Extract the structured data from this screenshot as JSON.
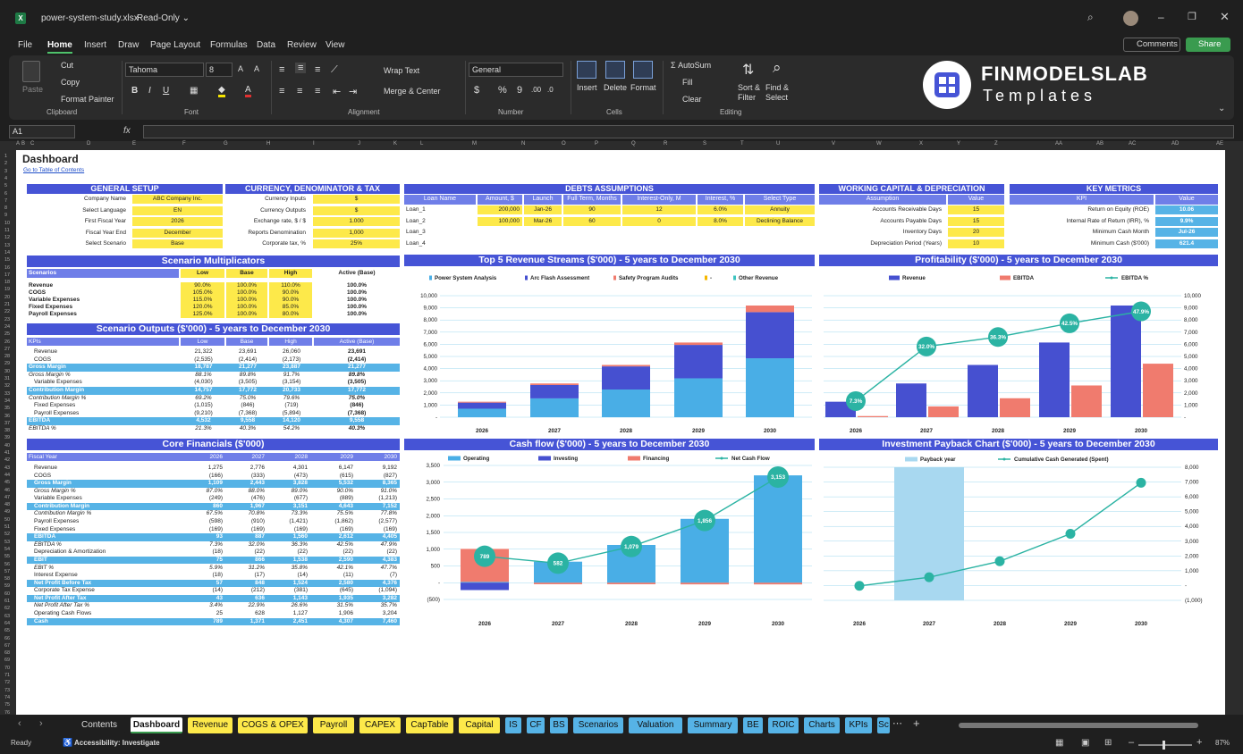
{
  "window": {
    "filename": "power-system-study.xlsx",
    "mode": "Read-Only"
  },
  "menu": [
    "File",
    "Home",
    "Insert",
    "Draw",
    "Page Layout",
    "Formulas",
    "Data",
    "Review",
    "View"
  ],
  "top_buttons": {
    "comments": "Comments",
    "share": "Share"
  },
  "ribbon": {
    "clipboard": {
      "paste": "Paste",
      "cut": "Cut",
      "copy": "Copy",
      "format_painter": "Format Painter",
      "label": "Clipboard"
    },
    "font": {
      "name": "Tahoma",
      "size": "8",
      "label": "Font"
    },
    "alignment": {
      "wrap": "Wrap Text",
      "merge": "Merge & Center",
      "label": "Alignment"
    },
    "number": {
      "format": "General",
      "label": "Number"
    },
    "cells": {
      "insert": "Insert",
      "delete": "Delete",
      "format": "Format",
      "label": "Cells"
    },
    "editing": {
      "autosum": "AutoSum",
      "fill": "Fill",
      "clear": "Clear",
      "sort": "Sort & Filter",
      "find": "Find & Select",
      "label": "Editing"
    },
    "logo": {
      "line1": "FINMODELSLAB",
      "line2": "Templates"
    }
  },
  "formula_bar": {
    "name_box": "A1",
    "fx": "fx"
  },
  "columns": [
    "A",
    "B",
    "C",
    "D",
    "E",
    "F",
    "G",
    "H",
    "I",
    "J",
    "K",
    "L",
    "M",
    "N",
    "O",
    "P",
    "Q",
    "R",
    "S",
    "T",
    "U",
    "V",
    "W",
    "X",
    "Y",
    "Z",
    "AA",
    "AB",
    "AC",
    "AD",
    "AE"
  ],
  "sheet": {
    "title": "Dashboard",
    "link": "Go to Table of Contents",
    "general_setup": {
      "title": "GENERAL SETUP",
      "rows": [
        [
          "Company Name",
          "ABC Company Inc."
        ],
        [
          "Select Language",
          "EN"
        ],
        [
          "First Fiscal Year",
          "2026"
        ],
        [
          "Fiscal Year End",
          "December"
        ],
        [
          "Select Scenario",
          "Base"
        ]
      ]
    },
    "currency": {
      "title": "CURRENCY, DENOMINATOR & TAX",
      "rows": [
        [
          "Currency Inputs",
          "$"
        ],
        [
          "Currency Outputs",
          "$"
        ],
        [
          "Exchange rate, $ / $",
          "1.000"
        ],
        [
          "Reports Denomination",
          "1,000"
        ],
        [
          "Corporate tax, %",
          "25%"
        ]
      ]
    },
    "debts": {
      "title": "DEBTS ASSUMPTIONS",
      "headers": [
        "Loan Name",
        "Amount, $",
        "Launch",
        "Full Term, Months",
        "Interest-Only, M",
        "Interest, %",
        "Select Type"
      ],
      "rows": [
        [
          "Loan_1",
          "200,000",
          "Jan-26",
          "90",
          "12",
          "6.0%",
          "Annuity"
        ],
        [
          "Loan_2",
          "100,000",
          "Mar-26",
          "60",
          "0",
          "8.0%",
          "Declining Balance"
        ],
        [
          "Loan_3",
          "",
          "",
          "",
          "",
          "",
          ""
        ],
        [
          "Loan_4",
          "",
          "",
          "",
          "",
          "",
          ""
        ]
      ]
    },
    "wc": {
      "title": "WORKING CAPITAL & DEPRECIATION",
      "headers": [
        "Assumption",
        "Value"
      ],
      "rows": [
        [
          "Accounts Receivable Days",
          "15"
        ],
        [
          "Accounts Payable Days",
          "15"
        ],
        [
          "Inventory Days",
          "20"
        ],
        [
          "Depreciation Period (Years)",
          "10"
        ]
      ]
    },
    "km": {
      "title": "KEY METRICS",
      "headers": [
        "KPI",
        "Value"
      ],
      "rows": [
        [
          "Return on Equity (ROE)",
          "10.06"
        ],
        [
          "Internal Rate of Return (IRR), %",
          "9.9%"
        ],
        [
          "Minimum Cash Month",
          "Jul-26"
        ],
        [
          "Minimum Cash ($'000)",
          "621.4"
        ]
      ]
    },
    "scen_mult": {
      "title": "Scenario Multiplicators",
      "headers": [
        "Scenarios",
        "Low",
        "Base",
        "High",
        "Active (Base)"
      ],
      "rows": [
        [
          "Revenue",
          "90.0%",
          "100.0%",
          "110.0%",
          "100.0%"
        ],
        [
          "COGS",
          "105.0%",
          "100.0%",
          "90.0%",
          "100.0%"
        ],
        [
          "Variable Expenses",
          "115.0%",
          "100.0%",
          "90.0%",
          "100.0%"
        ],
        [
          "Fixed Expenses",
          "120.0%",
          "100.0%",
          "85.0%",
          "100.0%"
        ],
        [
          "Payroll Expenses",
          "125.0%",
          "100.0%",
          "80.0%",
          "100.0%"
        ]
      ]
    },
    "scen_out": {
      "title": "Scenario Outputs ($'000) - 5 years to December 2030",
      "headers": [
        "KPIs",
        "Low",
        "Base",
        "High",
        "Active (Base)"
      ],
      "rows": [
        {
          "c": [
            "Revenue",
            "21,322",
            "23,691",
            "26,060",
            "23,691"
          ],
          "s": "n"
        },
        {
          "c": [
            "COGS",
            "(2,535)",
            "(2,414)",
            "(2,173)",
            "(2,414)"
          ],
          "s": "n"
        },
        {
          "c": [
            "Gross Margin",
            "18,787",
            "21,277",
            "23,887",
            "21,277"
          ],
          "s": "h"
        },
        {
          "c": [
            "Gross Margin %",
            "88.1%",
            "89.8%",
            "91.7%",
            "89.8%"
          ],
          "s": "i"
        },
        {
          "c": [
            "Variable Expenses",
            "(4,030)",
            "(3,505)",
            "(3,154)",
            "(3,505)"
          ],
          "s": "n"
        },
        {
          "c": [
            "Contribution Margin",
            "14,757",
            "17,772",
            "20,733",
            "17,772"
          ],
          "s": "h"
        },
        {
          "c": [
            "Contribution Margin %",
            "69.2%",
            "75.0%",
            "79.6%",
            "75.0%"
          ],
          "s": "i"
        },
        {
          "c": [
            "Fixed Expenses",
            "(1,015)",
            "(846)",
            "(719)",
            "(846)"
          ],
          "s": "n"
        },
        {
          "c": [
            "Payroll Expenses",
            "(9,210)",
            "(7,368)",
            "(5,894)",
            "(7,368)"
          ],
          "s": "n"
        },
        {
          "c": [
            "EBITDA",
            "4,532",
            "9,558",
            "14,120",
            "9,558"
          ],
          "s": "h"
        },
        {
          "c": [
            "EBITDA %",
            "21.3%",
            "40.3%",
            "54.2%",
            "40.3%"
          ],
          "s": "i"
        }
      ]
    },
    "core": {
      "title": "Core Financials ($'000)",
      "headers": [
        "Fiscal Year",
        "2026",
        "2027",
        "2028",
        "2029",
        "2030"
      ],
      "rows": [
        {
          "c": [
            "Revenue",
            "1,275",
            "2,776",
            "4,301",
            "6,147",
            "9,192"
          ],
          "s": "n"
        },
        {
          "c": [
            "COGS",
            "(166)",
            "(333)",
            "(473)",
            "(615)",
            "(827)"
          ],
          "s": "n"
        },
        {
          "c": [
            "Gross Margin",
            "1,109",
            "2,443",
            "3,828",
            "5,532",
            "8,365"
          ],
          "s": "h"
        },
        {
          "c": [
            "Gross Margin %",
            "87.0%",
            "88.0%",
            "89.0%",
            "90.0%",
            "91.0%"
          ],
          "s": "i"
        },
        {
          "c": [
            "Variable Expenses",
            "(249)",
            "(476)",
            "(677)",
            "(889)",
            "(1,213)"
          ],
          "s": "n"
        },
        {
          "c": [
            "Contribution Margin",
            "860",
            "1,967",
            "3,151",
            "4,643",
            "7,152"
          ],
          "s": "h"
        },
        {
          "c": [
            "Contribution Margin %",
            "67.5%",
            "70.8%",
            "73.3%",
            "75.5%",
            "77.8%"
          ],
          "s": "i"
        },
        {
          "c": [
            "Payroll Expenses",
            "(598)",
            "(910)",
            "(1,421)",
            "(1,862)",
            "(2,577)"
          ],
          "s": "n"
        },
        {
          "c": [
            "Fixed Expenses",
            "(169)",
            "(169)",
            "(169)",
            "(169)",
            "(169)"
          ],
          "s": "n"
        },
        {
          "c": [
            "EBITDA",
            "93",
            "887",
            "1,560",
            "2,612",
            "4,405"
          ],
          "s": "h"
        },
        {
          "c": [
            "EBITDA %",
            "7.3%",
            "32.0%",
            "36.3%",
            "42.5%",
            "47.9%"
          ],
          "s": "i"
        },
        {
          "c": [
            "Depreciation & Amortization",
            "(18)",
            "(22)",
            "(22)",
            "(22)",
            "(22)"
          ],
          "s": "n"
        },
        {
          "c": [
            "EBIT",
            "75",
            "866",
            "1,538",
            "2,590",
            "4,383"
          ],
          "s": "h"
        },
        {
          "c": [
            "EBIT %",
            "5.9%",
            "31.2%",
            "35.8%",
            "42.1%",
            "47.7%"
          ],
          "s": "i"
        },
        {
          "c": [
            "Interest Expense",
            "(18)",
            "(17)",
            "(14)",
            "(11)",
            "(7)"
          ],
          "s": "n"
        },
        {
          "c": [
            "Net Profit Before Tax",
            "57",
            "848",
            "1,524",
            "2,580",
            "4,376"
          ],
          "s": "h"
        },
        {
          "c": [
            "Corporate Tax Expense",
            "(14)",
            "(212)",
            "(381)",
            "(645)",
            "(1,094)"
          ],
          "s": "n"
        },
        {
          "c": [
            "Net Profit After Tax",
            "43",
            "636",
            "1,143",
            "1,935",
            "3,282"
          ],
          "s": "h"
        },
        {
          "c": [
            "Net Profit After Tax %",
            "3.4%",
            "22.9%",
            "26.6%",
            "31.5%",
            "35.7%"
          ],
          "s": "i"
        },
        {
          "c": [
            "Operating Cash Flows",
            "25",
            "628",
            "1,127",
            "1,906",
            "3,204"
          ],
          "s": "n"
        },
        {
          "c": [
            "Cash",
            "789",
            "1,371",
            "2,451",
            "4,307",
            "7,460"
          ],
          "s": "h"
        }
      ]
    }
  },
  "chart_data": [
    {
      "type": "bar",
      "title": "Top 5 Revenue Streams ($'000) - 5 years to December 2030",
      "categories": [
        "2026",
        "2027",
        "2028",
        "2029",
        "2030"
      ],
      "stacked": true,
      "ylim": [
        0,
        10000
      ],
      "yticks": [
        "-",
        "1,000",
        "2,000",
        "3,000",
        "4,000",
        "5,000",
        "6,000",
        "7,000",
        "8,000",
        "9,000",
        "10,000"
      ],
      "series": [
        {
          "name": "Power System Analysis",
          "color": "#49aee6",
          "values": [
            700,
            1550,
            2280,
            3200,
            4850
          ]
        },
        {
          "name": "Arc Flash Assessment",
          "color": "#4650d0",
          "values": [
            500,
            1100,
            1900,
            2750,
            3800
          ]
        },
        {
          "name": "Safety Program Audits",
          "color": "#f07b6e",
          "values": [
            75,
            126,
            121,
            197,
            542
          ]
        },
        {
          "name": "-",
          "color": "#f5b700",
          "values": [
            0,
            0,
            0,
            0,
            0
          ]
        },
        {
          "name": "Other Revenue",
          "color": "#3dc4c0",
          "values": [
            0,
            0,
            0,
            0,
            0
          ]
        }
      ]
    },
    {
      "type": "bar+line",
      "title": "Profitability ($'000) - 5 years to December 2030",
      "categories": [
        "2026",
        "2027",
        "2028",
        "2029",
        "2030"
      ],
      "ylim": [
        0,
        10000
      ],
      "yticks": [
        "-",
        "1,000",
        "2,000",
        "3,000",
        "4,000",
        "5,000",
        "6,000",
        "7,000",
        "8,000",
        "9,000",
        "10,000"
      ],
      "series": [
        {
          "name": "Revenue",
          "color": "#4650d0",
          "values": [
            1275,
            2776,
            4301,
            6147,
            9192
          ]
        },
        {
          "name": "EBITDA",
          "color": "#f07b6e",
          "values": [
            93,
            887,
            1560,
            2612,
            4405
          ]
        },
        {
          "name": "EBITDA %",
          "color": "#2bb3a3",
          "values": [
            7.3,
            32.0,
            36.3,
            42.5,
            47.9
          ],
          "labels": [
            "7.3%",
            "32.0%",
            "36.3%",
            "42.5%",
            "47.9%"
          ]
        }
      ]
    },
    {
      "type": "bar+line",
      "title": "Cash flow ($'000) - 5 years to December 2030",
      "categories": [
        "2026",
        "2027",
        "2028",
        "2029",
        "2030"
      ],
      "ylim": [
        -500,
        3500
      ],
      "yticks": [
        "(500)",
        "-",
        "500",
        "1,000",
        "1,500",
        "2,000",
        "2,500",
        "3,000",
        "3,500"
      ],
      "series": [
        {
          "name": "Operating",
          "color": "#49aee6",
          "values": [
            25,
            628,
            1127,
            1906,
            3204
          ]
        },
        {
          "name": "Investing",
          "color": "#4650d0",
          "values": [
            -220,
            0,
            0,
            0,
            0
          ]
        },
        {
          "name": "Financing",
          "color": "#f07b6e",
          "values": [
            984,
            -46,
            -47,
            -50,
            -51
          ]
        },
        {
          "name": "Net Cash Flow",
          "color": "#2bb3a3",
          "values": [
            789,
            582,
            1079,
            1856,
            3153
          ],
          "labels": [
            "789",
            "582",
            "1,079",
            "1,856",
            "3,153"
          ]
        }
      ]
    },
    {
      "type": "bar+line",
      "title": "Investment Payback Chart ($'000) - 5 years to December 2030",
      "categories": [
        "2026",
        "2027",
        "2028",
        "2029",
        "2030"
      ],
      "ylim": [
        -1000,
        8000
      ],
      "yticks": [
        "(1,000)",
        "-",
        "1,000",
        "2,000",
        "3,000",
        "4,000",
        "5,000",
        "6,000",
        "7,000",
        "8,000"
      ],
      "series": [
        {
          "name": "Payback year",
          "color": "#a8d8f0",
          "values": [
            0,
            1,
            0,
            0,
            0
          ]
        },
        {
          "name": "Cumulative Cash Generated (Spent)",
          "color": "#2bb3a3",
          "values": [
            -20,
            560,
            1640,
            3500,
            6950
          ]
        }
      ]
    }
  ],
  "sheet_tabs": [
    {
      "label": "Contents",
      "color": "#1f1f1f",
      "fg": "#ddd"
    },
    {
      "label": "Dashboard",
      "color": "#ffffff",
      "fg": "#111"
    },
    {
      "label": "Revenue",
      "color": "#fde94a",
      "fg": "#111"
    },
    {
      "label": "COGS & OPEX",
      "color": "#fde94a",
      "fg": "#111"
    },
    {
      "label": "Payroll",
      "color": "#fde94a",
      "fg": "#111"
    },
    {
      "label": "CAPEX",
      "color": "#fde94a",
      "fg": "#111"
    },
    {
      "label": "CapTable",
      "color": "#fde94a",
      "fg": "#111"
    },
    {
      "label": "Capital",
      "color": "#fde94a",
      "fg": "#111"
    },
    {
      "label": "IS",
      "color": "#56b3e6",
      "fg": "#111"
    },
    {
      "label": "CF",
      "color": "#56b3e6",
      "fg": "#111"
    },
    {
      "label": "BS",
      "color": "#56b3e6",
      "fg": "#111"
    },
    {
      "label": "Scenarios",
      "color": "#56b3e6",
      "fg": "#111"
    },
    {
      "label": "Valuation",
      "color": "#56b3e6",
      "fg": "#111"
    },
    {
      "label": "Summary",
      "color": "#56b3e6",
      "fg": "#111"
    },
    {
      "label": "BE",
      "color": "#56b3e6",
      "fg": "#111"
    },
    {
      "label": "ROIC",
      "color": "#56b3e6",
      "fg": "#111"
    },
    {
      "label": "Charts",
      "color": "#56b3e6",
      "fg": "#111"
    },
    {
      "label": "KPIs",
      "color": "#56b3e6",
      "fg": "#111"
    },
    {
      "label": "Sc",
      "color": "#56b3e6",
      "fg": "#111"
    }
  ],
  "status": {
    "ready": "Ready",
    "accessibility": "Accessibility: Investigate",
    "zoom": "87%"
  }
}
